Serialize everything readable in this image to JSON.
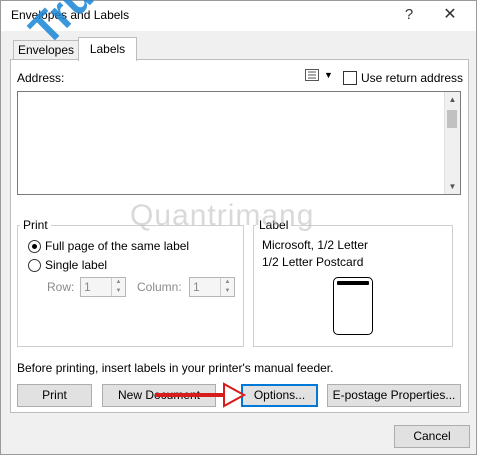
{
  "window": {
    "title": "Envelopes and Labels",
    "help": "?",
    "close": "✕"
  },
  "tabs": [
    {
      "label": "Envelopes"
    },
    {
      "label": "Labels"
    }
  ],
  "address": {
    "label": "Address:",
    "value": "",
    "use_return_address": "Use return address"
  },
  "print_group": {
    "title": "Print",
    "full_page": "Full page of the same label",
    "single": "Single label",
    "row_label": "Row:",
    "row_value": "1",
    "column_label": "Column:",
    "column_value": "1"
  },
  "label_group": {
    "title": "Label",
    "line1": "Microsoft, 1/2 Letter",
    "line2": "1/2 Letter Postcard"
  },
  "note": "Before printing, insert labels in your printer's manual feeder.",
  "buttons": {
    "print": "Print",
    "new_document": "New Document",
    "options": "Options...",
    "epostage": "E-postage Properties...",
    "cancel": "Cancel"
  },
  "watermarks": {
    "truongtin": "Truongtin.top",
    "quantrimang": "Quantrimang"
  },
  "colors": {
    "accent": "#0078d7",
    "arrow": "#d61c1c",
    "watermark": "#1a86d6"
  }
}
